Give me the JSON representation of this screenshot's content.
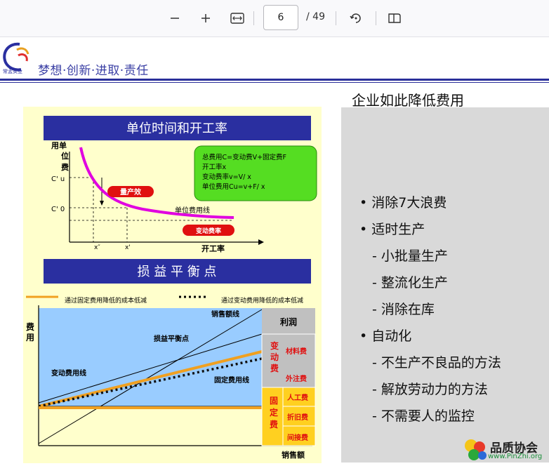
{
  "toolbar": {
    "page_number": "6",
    "page_total": "/ 49"
  },
  "header": {
    "slogan": "梦想·创新·进取·责任",
    "logo_text": "常孟实业"
  },
  "slide": {
    "title": "企业如此降低费用",
    "bullets": [
      {
        "level": 1,
        "text": "消除7大浪费"
      },
      {
        "level": 1,
        "text": "适时生产"
      },
      {
        "level": 2,
        "text": "小批量生产"
      },
      {
        "level": 2,
        "text": "整流化生产"
      },
      {
        "level": 2,
        "text": "消除在库"
      },
      {
        "level": 1,
        "text": "自动化"
      },
      {
        "level": 2,
        "text": "不生产不良品的方法"
      },
      {
        "level": 2,
        "text": "解放劳动力的方法"
      },
      {
        "level": 2,
        "text": "不需要人的监控"
      }
    ],
    "bullet_dot": "•",
    "bullet_dash": "-"
  },
  "figure": {
    "top_title": "单位时间和开工率",
    "top_yaxis": [
      "用单",
      "位",
      "费"
    ],
    "cu_prime": "C' u",
    "cu_zero": "C' 0",
    "x_prime2": "x″",
    "x_prime": "x'",
    "xaxis_label": "开工率",
    "curve_label": "单位费用线",
    "badge_output": "量产效",
    "badge_rate": "变动费率",
    "formula": [
      "总费用C=变动费V+固定费F",
      "开工率x",
      "变动费率v=V/ x",
      "单位费用Cu=v+F/ x"
    ],
    "bottom_title": "损 益 平 衡 点",
    "legend_fixed": "通过固定费用降低的成本低减",
    "legend_variable": "通过变动费用降低的成本低减",
    "bottom_yaxis": [
      "费",
      "用"
    ],
    "sales_line": "销售额线",
    "breakeven": "损益平衡点",
    "variable_line": "变动费用线",
    "fixed_line": "固定费用线",
    "xaxis_sales": "销售额",
    "profit": "利润",
    "variable_cost": [
      "变",
      "动",
      "费"
    ],
    "material": "材料费",
    "outsourcing": "外注费",
    "fixed_cost": [
      "固",
      "定",
      "费"
    ],
    "labor": "人工费",
    "depreciation": "折旧费",
    "indirect": "间接费"
  },
  "watermark": {
    "name": "品质协会",
    "url": "www.PinZhi.org"
  },
  "colors": {
    "title_bar": "#2a2fa0",
    "magenta_curve": "#e000e0",
    "badge_red": "#e01010",
    "green_box": "#55dd22",
    "orange_line": "#f0a020",
    "blue_area": "#99ccff"
  }
}
